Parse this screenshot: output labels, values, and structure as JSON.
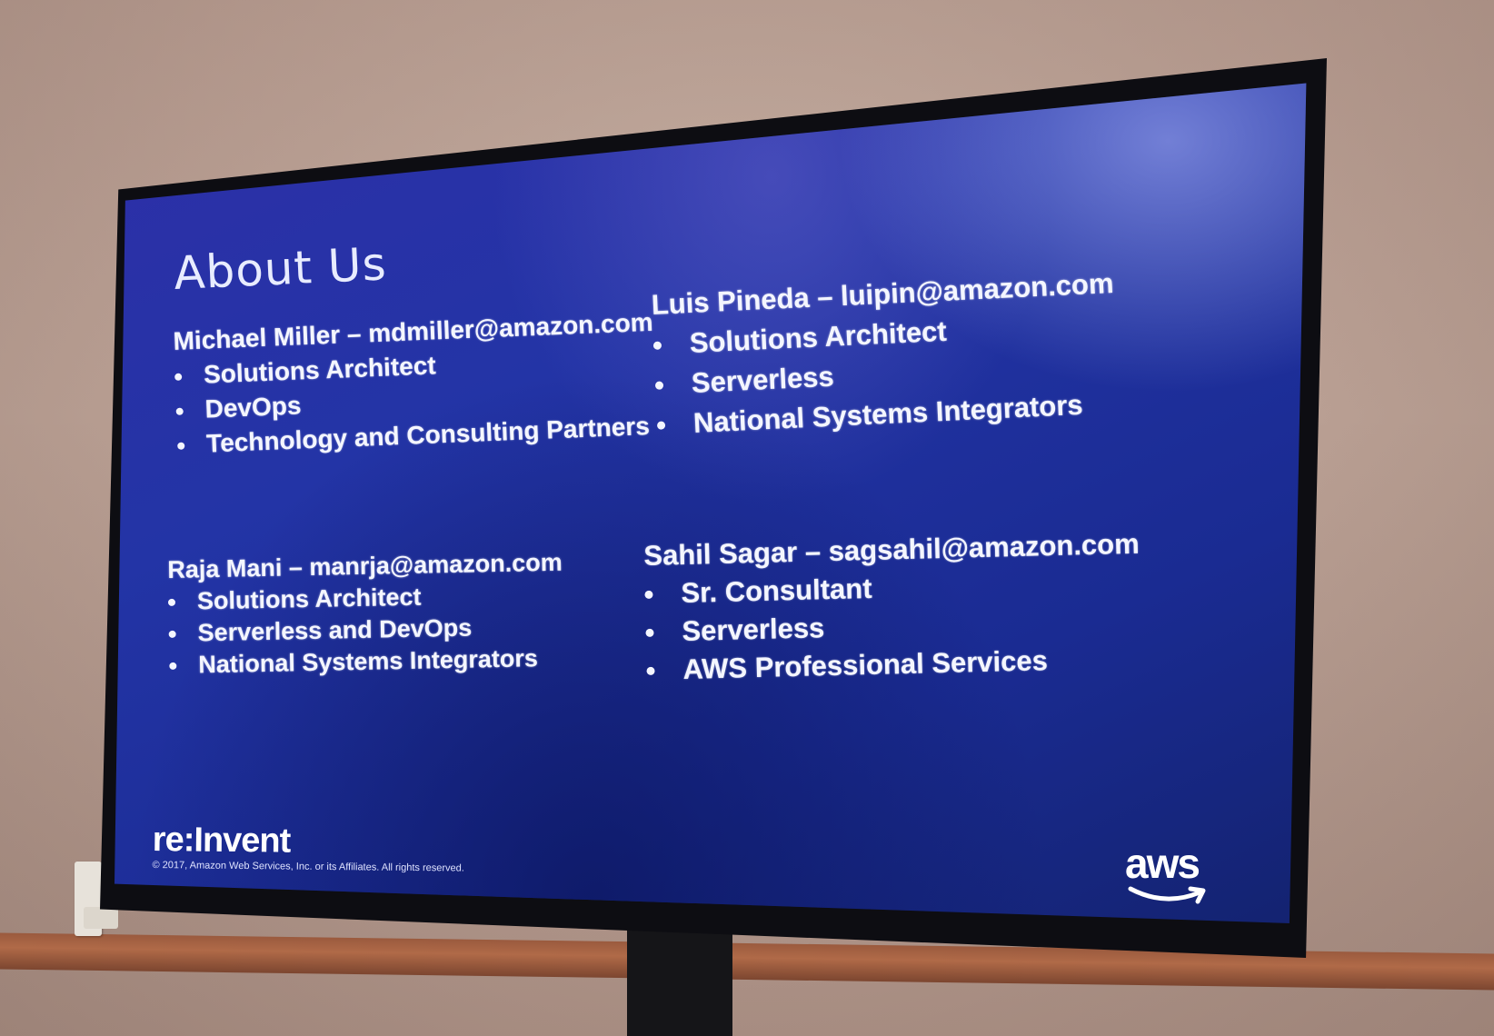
{
  "slide": {
    "title": "About Us",
    "people": [
      {
        "name": "Michael Miller – mdmiller@amazon.com",
        "roles": [
          "Solutions Architect",
          "DevOps",
          "Technology and Consulting Partners"
        ]
      },
      {
        "name": "Luis Pineda – luipin@amazon.com",
        "roles": [
          "Solutions Architect",
          "Serverless",
          "National Systems Integrators"
        ]
      },
      {
        "name": "Raja Mani – manrja@amazon.com",
        "roles": [
          "Solutions Architect",
          "Serverless and DevOps",
          "National Systems Integrators"
        ]
      },
      {
        "name": "Sahil Sagar – sagsahil@amazon.com",
        "roles": [
          "Sr. Consultant",
          "Serverless",
          "AWS Professional Services"
        ]
      }
    ],
    "footer": {
      "logo_text": "re:Invent",
      "copyright": "© 2017, Amazon Web Services, Inc. or its Affiliates. All rights reserved.",
      "brand_logo_text": "aws"
    }
  },
  "colors": {
    "slide_background": "#2334a6",
    "text": "#f4f6ff",
    "bezel": "#0d0d12",
    "wall": "#b99f93",
    "rail": "#9a5a3e"
  }
}
